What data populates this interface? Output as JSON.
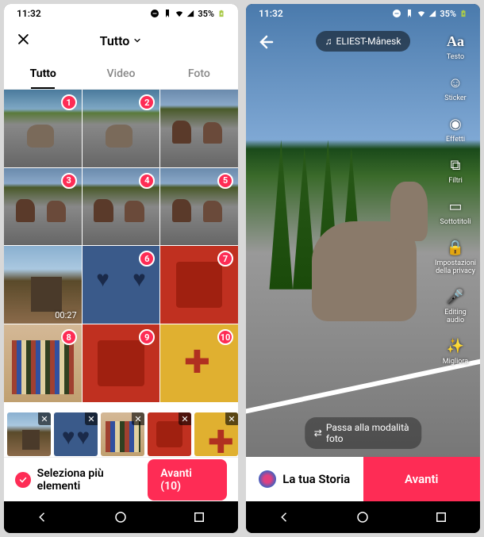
{
  "status": {
    "time": "11:32",
    "battery_pct": "35%"
  },
  "picker": {
    "title": "Tutto",
    "tabs": {
      "all": "Tutto",
      "video": "Video",
      "photo": "Foto"
    },
    "items": [
      {
        "badge": "1",
        "type": "donkey-road"
      },
      {
        "badge": "2",
        "type": "donkey-road"
      },
      {
        "badge": "",
        "type": "cows"
      },
      {
        "badge": "3",
        "type": "cows"
      },
      {
        "badge": "4",
        "type": "cows"
      },
      {
        "badge": "5",
        "type": "cows"
      },
      {
        "badge": "",
        "type": "cabin",
        "duration": "00:27"
      },
      {
        "badge": "6",
        "type": "blue-door"
      },
      {
        "badge": "7",
        "type": "red-box"
      },
      {
        "badge": "8",
        "type": "books"
      },
      {
        "badge": "9",
        "type": "red-box"
      },
      {
        "badge": "10",
        "type": "yellow-box"
      }
    ],
    "strip": [
      {
        "type": "cabin"
      },
      {
        "type": "blue-door"
      },
      {
        "type": "books"
      },
      {
        "type": "red-box"
      },
      {
        "type": "yellow-box"
      }
    ],
    "select_multi": "Seleziona più elementi",
    "next": "Avanti (10)"
  },
  "editor": {
    "music": "ELIEST-Månesk",
    "tools": {
      "text": "Testo",
      "sticker": "Sticker",
      "effects": "Effetti",
      "filters": "Filtri",
      "subtitles": "Sottotitoli",
      "privacy": "Impostazioni della privacy",
      "audio": "Editing audio",
      "enhance": "Migliora"
    },
    "mode_switch": "Passa alla modalità foto",
    "story_btn": "La tua Storia",
    "next": "Avanti"
  }
}
